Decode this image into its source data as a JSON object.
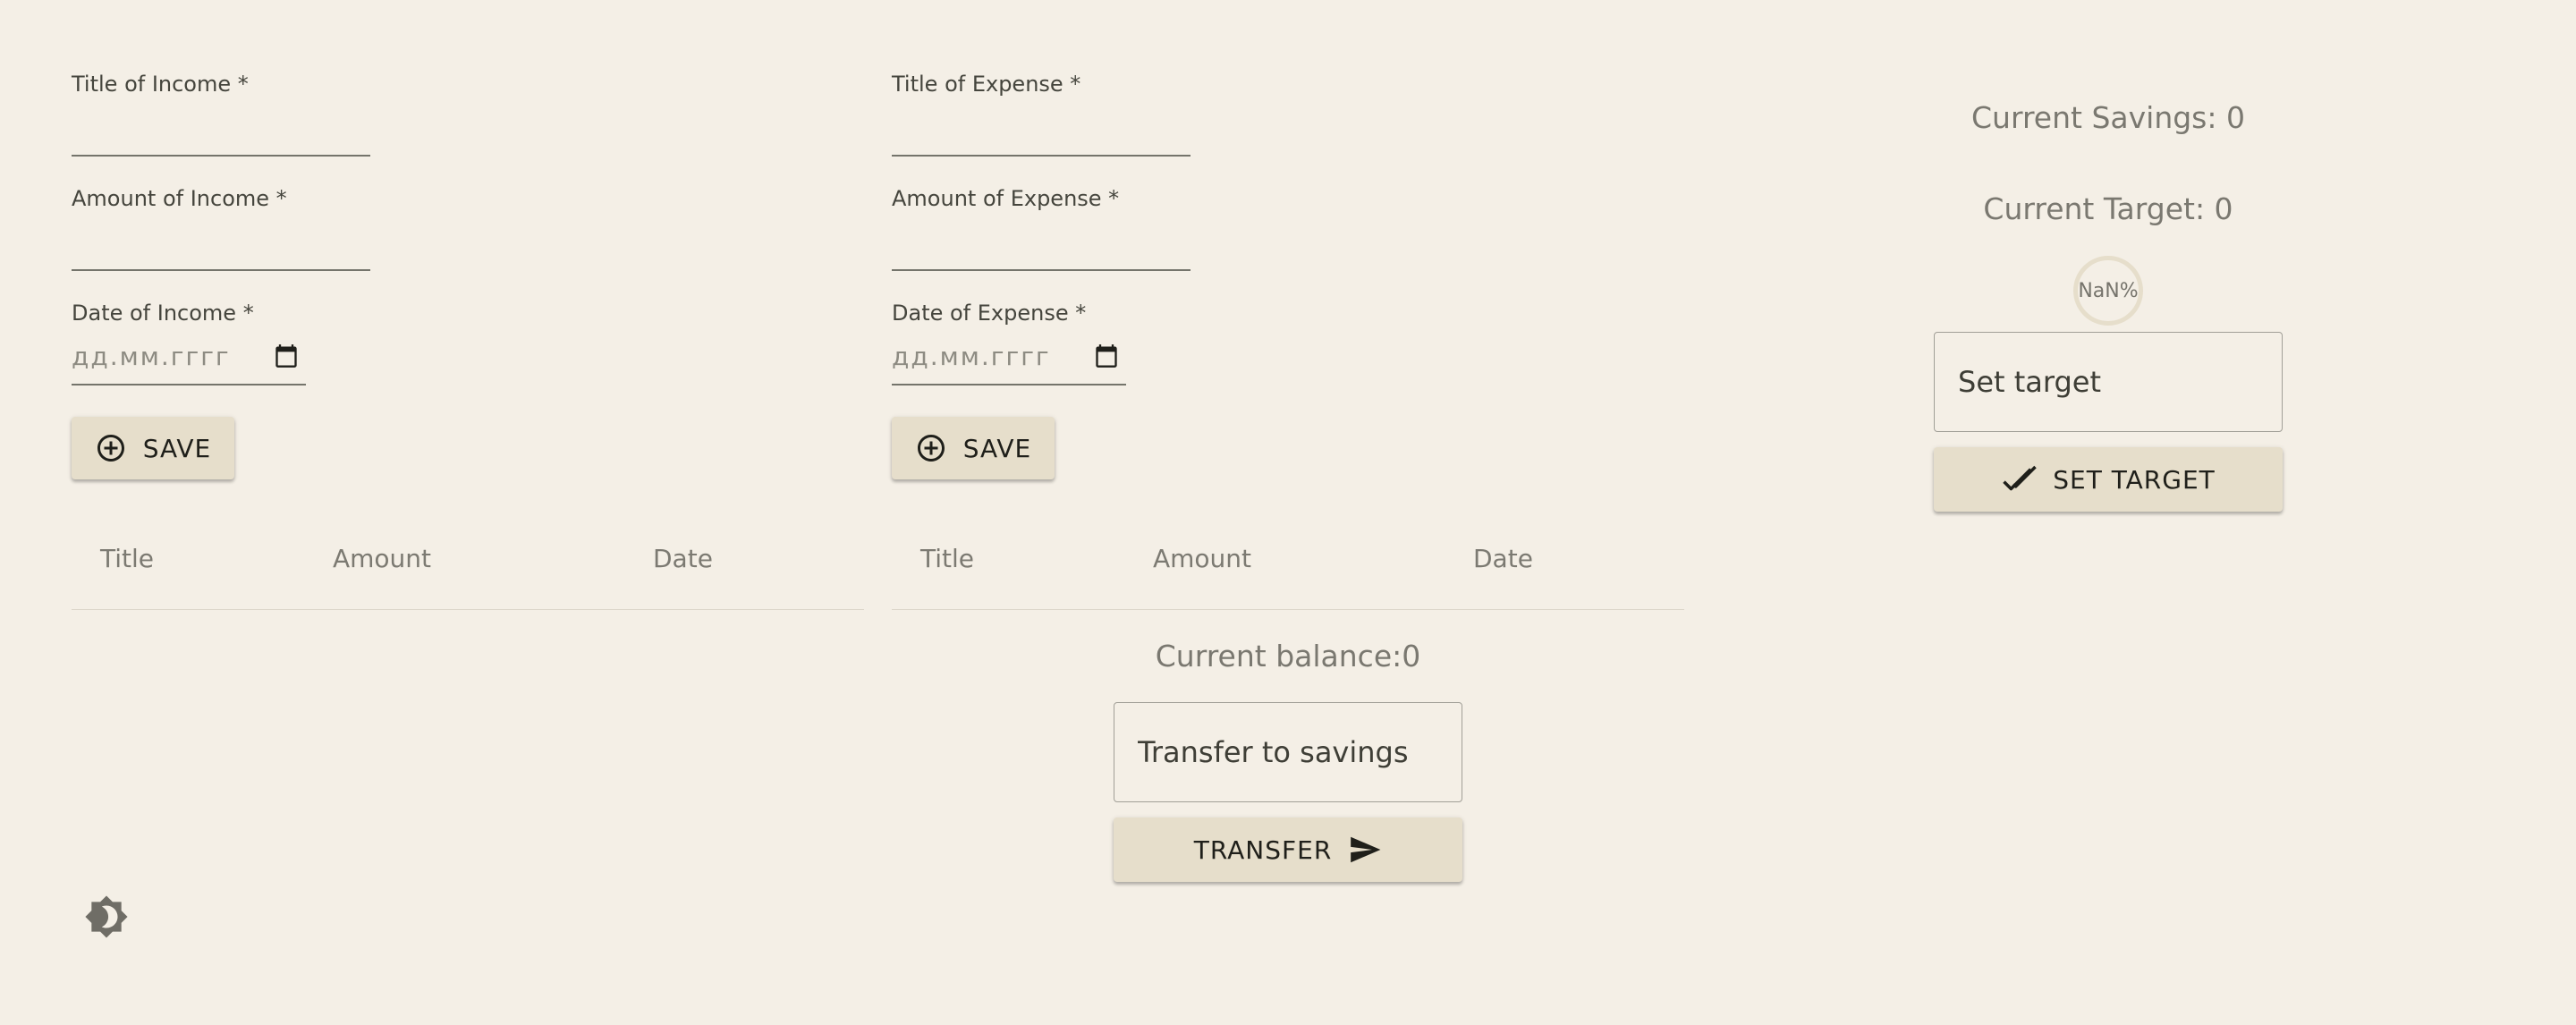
{
  "income": {
    "title_label": "Title of Income *",
    "amount_label": "Amount of Income *",
    "date_label": "Date of Income *",
    "date_placeholder": "дд.мм.гггг",
    "save_label": "SAVE"
  },
  "expense": {
    "title_label": "Title of Expense *",
    "amount_label": "Amount of Expense *",
    "date_label": "Date of Expense *",
    "date_placeholder": "дд.мм.гггг",
    "save_label": "SAVE"
  },
  "income_table": {
    "columns": [
      "Title",
      "Amount",
      "Date"
    ],
    "rows": []
  },
  "expense_table": {
    "columns": [
      "Title",
      "Amount",
      "Date"
    ],
    "rows": []
  },
  "balance": {
    "text": "Current balance:0",
    "transfer_placeholder": "Transfer to savings",
    "transfer_label": "TRANSFER"
  },
  "savings": {
    "current_savings": "Current Savings: 0",
    "current_target": "Current Target: 0",
    "progress_text": "NaN%",
    "target_placeholder": "Set target",
    "set_target_label": "SET TARGET"
  },
  "theme": {
    "icon": "brightness-toggle-icon"
  },
  "colors": {
    "background": "#f4efe6",
    "button": "#e6decb",
    "text_muted": "#7c7a72"
  }
}
